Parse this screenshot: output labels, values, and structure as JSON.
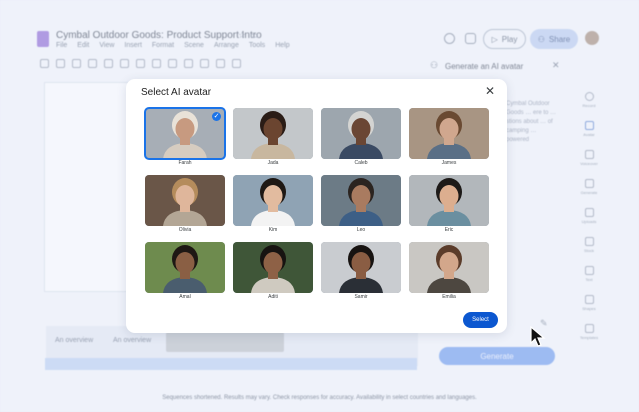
{
  "app": {
    "doc_title": "Cymbal Outdoor Goods: Product Support Intro",
    "menu": [
      "File",
      "Edit",
      "View",
      "Insert",
      "Format",
      "Scene",
      "Arrange",
      "Tools",
      "Help"
    ],
    "play_label": "Play",
    "share_label": "Share",
    "side_panel_title": "Generate an AI avatar",
    "side_panel_text": "Cymbal Outdoor Goods … ere to … stions about … of camping … powered",
    "sidebar": [
      "Record",
      "Avatar",
      "Voiceover",
      "Generate",
      "Uploads",
      "Stock",
      "Text",
      "Shapes",
      "Templates"
    ],
    "scene_labels": [
      "An overview",
      "An overview"
    ],
    "generate_label": "Generate",
    "disclaimer": "Sequences shortened. Results may vary. Check responses for accuracy. Availability in select countries and languages."
  },
  "dialog": {
    "title": "Select AI avatar",
    "select_label": "Select",
    "selected_index": 0,
    "avatars": [
      {
        "name": "Farah",
        "bg": "#a7aeb6",
        "skin": "#c79a80",
        "hair": "#e9e2d8",
        "shirt": "#d6ccc0"
      },
      {
        "name": "Jada",
        "bg": "#c3c7ca",
        "skin": "#6b4530",
        "hair": "#2a1c16",
        "shirt": "#c8b79f"
      },
      {
        "name": "Caleb",
        "bg": "#9da6ae",
        "skin": "#6a4634",
        "hair": "#d4d4d2",
        "shirt": "#3a4a63"
      },
      {
        "name": "James",
        "bg": "#a89583",
        "skin": "#d0a78e",
        "hair": "#6a4a32",
        "shirt": "#5a6f86"
      },
      {
        "name": "Olivia",
        "bg": "#6a5648",
        "skin": "#dfb69b",
        "hair": "#b58c5c",
        "shirt": "#b3a695"
      },
      {
        "name": "Kim",
        "bg": "#8fa3b4",
        "skin": "#e2bb9f",
        "hair": "#1e1814",
        "shirt": "#f3f3f3"
      },
      {
        "name": "Leo",
        "bg": "#6c7b86",
        "skin": "#a97b60",
        "hair": "#2b2420",
        "shirt": "#3d5f86"
      },
      {
        "name": "Eric",
        "bg": "#b2b7bb",
        "skin": "#dcae8f",
        "hair": "#1d1a18",
        "shirt": "#6b8fa0"
      },
      {
        "name": "Amal",
        "bg": "#6e8b4e",
        "skin": "#8a5f44",
        "hair": "#1e1814",
        "shirt": "#4a5d6e"
      },
      {
        "name": "Aditi",
        "bg": "#3f5638",
        "skin": "#8e6146",
        "hair": "#171311",
        "shirt": "#cfcac0"
      },
      {
        "name": "Samir",
        "bg": "#c9ccd0",
        "skin": "#8a5d43",
        "hair": "#171311",
        "shirt": "#2a2f36"
      },
      {
        "name": "Emilia",
        "bg": "#c9c7c3",
        "skin": "#d3a78b",
        "hair": "#5b3c2a",
        "shirt": "#4d4740"
      }
    ]
  }
}
